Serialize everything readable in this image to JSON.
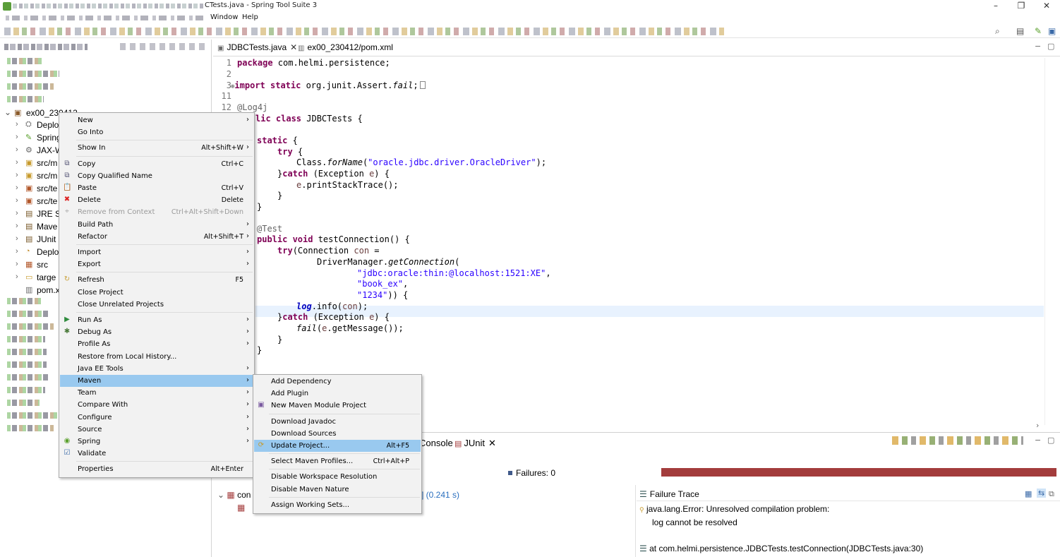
{
  "window": {
    "title": "CTests.java - Spring Tool Suite 3",
    "minimize": "–",
    "restore": "❐",
    "close": "✕"
  },
  "menubar": {
    "items": [
      "Window",
      "Help"
    ]
  },
  "explorer": {
    "project_name": "ex00_230412"
  },
  "tree_items": [
    {
      "label": "Deplo",
      "icon": "deployment-icon",
      "glyph": "⛭",
      "color": "#6b6b6b"
    },
    {
      "label": "Spring",
      "icon": "spring-icon",
      "glyph": "✎",
      "color": "#5aa02c"
    },
    {
      "label": "JAX-W",
      "icon": "jaxws-icon",
      "glyph": "⚙",
      "color": "#666"
    },
    {
      "label": "src/m",
      "icon": "source-folder-icon",
      "glyph": "▣",
      "color": "#c79a2c"
    },
    {
      "label": "src/m",
      "icon": "source-folder-icon",
      "glyph": "▣",
      "color": "#c79a2c"
    },
    {
      "label": "src/te",
      "icon": "test-folder-icon",
      "glyph": "▣",
      "color": "#b2572a"
    },
    {
      "label": "src/te",
      "icon": "test-folder-icon",
      "glyph": "▣",
      "color": "#b2572a"
    },
    {
      "label": "JRE S",
      "icon": "library-icon",
      "glyph": "▤",
      "color": "#7a5a2a"
    },
    {
      "label": "Mave",
      "icon": "library-icon",
      "glyph": "▤",
      "color": "#7a5a2a"
    },
    {
      "label": "JUnit",
      "icon": "library-icon",
      "glyph": "▤",
      "color": "#7a5a2a"
    },
    {
      "label": "Deplo",
      "icon": "deployment-icon",
      "glyph": "◔",
      "color": "#c08a2a"
    },
    {
      "label": "src",
      "icon": "folder-icon",
      "glyph": "▦",
      "color": "#b2572a"
    },
    {
      "label": "targe",
      "icon": "folder-icon",
      "glyph": "▭",
      "color": "#c79a2c"
    },
    {
      "label": "pom.x",
      "icon": "xml-file-icon",
      "glyph": "▥",
      "color": "#6b6b6b"
    }
  ],
  "editor": {
    "tabs": [
      {
        "label": "JDBCTests.java",
        "close": "✕"
      },
      {
        "label": "ex00_230412/pom.xml"
      }
    ],
    "line_numbers": [
      "1",
      "2",
      "3",
      "11",
      "12"
    ],
    "code": {
      "l1_kw": "package",
      "l1_rest": " com.helmi.persistence;",
      "l3_fold": "⊕",
      "l3_kw1": "import",
      "l3_kw2": " static",
      "l3_rest": " org.junit.Assert.",
      "l3_it": "fail",
      "l3_end": ";",
      "l12_ann": "@Log4j",
      "l13_kw": "lic class",
      "l13_rest": " JDBCTests {",
      "l15_kw": "static",
      "l15_rest": " {",
      "l16_kw": "try",
      "l16_rest": " {",
      "l17_a": "Class.",
      "l17_it": "forName",
      "l17_b": "(",
      "l17_str": "\"oracle.jdbc.driver.OracleDriver\"",
      "l17_c": ");",
      "l18_a": "}",
      "l18_kw": "catch",
      "l18_b": " (Exception ",
      "l18_var": "e",
      "l18_c": ") {",
      "l19_var": "e",
      "l19_rest": ".printStackTrace();",
      "l20": "}",
      "l21": "}",
      "l23_ann": "@Test",
      "l24_kw": "public void",
      "l24_rest": " testConnection() {",
      "l25_kw": "try",
      "l25_a": "(Connection ",
      "l25_var": "con",
      "l25_b": " =",
      "l26_a": "DriverManager.",
      "l26_it": "getConnection",
      "l26_b": "(",
      "l27_str": "\"jdbc:oracle:thin:@localhost:1521:XE\"",
      "l27_b": ",",
      "l28_str": "\"book_ex\"",
      "l28_b": ",",
      "l29_str": "\"1234\"",
      "l29_b": ")) {",
      "l30_fld": "log",
      "l30_a": ".info(",
      "l30_var": "con",
      "l30_b": ");",
      "l31_a": "}",
      "l31_kw": "catch",
      "l31_b": " (Exception ",
      "l31_var": "e",
      "l31_c": ") {",
      "l32_it": "fail",
      "l32_a": "(",
      "l32_var": "e",
      "l32_b": ".getMessage());",
      "l33": "}",
      "l34": "}"
    }
  },
  "bottom_panel": {
    "tabs": [
      {
        "label": "Console"
      },
      {
        "label": "JUnit",
        "close": "✕"
      }
    ],
    "failures_label": "Failures:",
    "failures_count": "0",
    "progress_fraction": 1.0,
    "progress_color": "#a33c3c",
    "result_root_label": "con",
    "elapsed": "] (0.241 s)",
    "failure_trace_title": "Failure Trace",
    "trace_lines": [
      "java.lang.Error: Unresolved compilation problem:",
      "log cannot be resolved",
      "at com.helmi.persistence.JDBCTests.testConnection(JDBCTests.java:30)"
    ]
  },
  "context_menu": {
    "items": [
      {
        "label": "New",
        "submenu": true
      },
      {
        "label": "Go Into"
      },
      {
        "sep": true
      },
      {
        "label": "Show In",
        "shortcut": "Alt+Shift+W",
        "submenu": true
      },
      {
        "sep": true
      },
      {
        "label": "Copy",
        "shortcut": "Ctrl+C",
        "icon": "copy-icon",
        "glyph": "⧉",
        "color": "#557"
      },
      {
        "label": "Copy Qualified Name",
        "icon": "copy-qualified-name-icon",
        "glyph": "⧉",
        "color": "#557"
      },
      {
        "label": "Paste",
        "shortcut": "Ctrl+V",
        "icon": "paste-icon",
        "glyph": "📋",
        "color": "#8a6a2a"
      },
      {
        "label": "Delete",
        "shortcut": "Delete",
        "icon": "delete-icon",
        "glyph": "✖",
        "color": "#d22"
      },
      {
        "label": "Remove from Context",
        "shortcut": "Ctrl+Alt+Shift+Down",
        "disabled": true,
        "icon": "remove-context-icon",
        "glyph": "⌖",
        "color": "#aaa"
      },
      {
        "label": "Build Path",
        "submenu": true
      },
      {
        "label": "Refactor",
        "shortcut": "Alt+Shift+T",
        "submenu": true
      },
      {
        "sep": true
      },
      {
        "label": "Import",
        "submenu": true
      },
      {
        "label": "Export",
        "submenu": true
      },
      {
        "sep": true
      },
      {
        "label": "Refresh",
        "shortcut": "F5",
        "icon": "refresh-icon",
        "glyph": "↻",
        "color": "#c9a038"
      },
      {
        "label": "Close Project"
      },
      {
        "label": "Close Unrelated Projects"
      },
      {
        "sep": true
      },
      {
        "label": "Run As",
        "submenu": true,
        "icon": "run-icon",
        "glyph": "▶",
        "color": "#2e8b3c"
      },
      {
        "label": "Debug As",
        "submenu": true,
        "icon": "debug-icon",
        "glyph": "✱",
        "color": "#4a7a3a"
      },
      {
        "label": "Profile As",
        "submenu": true
      },
      {
        "label": "Restore from Local History..."
      },
      {
        "label": "Java EE Tools",
        "submenu": true
      },
      {
        "label": "Maven",
        "submenu": true,
        "selected": true
      },
      {
        "label": "Team",
        "submenu": true
      },
      {
        "label": "Compare With",
        "submenu": true
      },
      {
        "label": "Configure",
        "submenu": true
      },
      {
        "label": "Source",
        "submenu": true
      },
      {
        "label": "Spring",
        "submenu": true,
        "icon": "spring-icon",
        "glyph": "◉",
        "color": "#5aa02c"
      },
      {
        "label": "Validate",
        "icon": "validate-icon",
        "glyph": "☑",
        "color": "#3a6aa8"
      },
      {
        "sep": true
      },
      {
        "label": "Properties",
        "shortcut": "Alt+Enter"
      }
    ]
  },
  "maven_submenu": {
    "items": [
      {
        "label": "Add Dependency"
      },
      {
        "label": "Add Plugin"
      },
      {
        "label": "New Maven Module Project",
        "icon": "maven-module-icon",
        "glyph": "▣",
        "color": "#7a5aa0"
      },
      {
        "sep": true
      },
      {
        "label": "Download Javadoc"
      },
      {
        "label": "Download Sources"
      },
      {
        "label": "Update Project...",
        "shortcut": "Alt+F5",
        "selected": true,
        "icon": "update-project-icon",
        "glyph": "⟳",
        "color": "#c79a2c"
      },
      {
        "sep": true
      },
      {
        "label": "Select Maven Profiles...",
        "shortcut": "Ctrl+Alt+P"
      },
      {
        "sep": true
      },
      {
        "label": "Disable Workspace Resolution"
      },
      {
        "label": "Disable Maven Nature"
      },
      {
        "sep": true
      },
      {
        "label": "Assign Working Sets..."
      }
    ]
  }
}
